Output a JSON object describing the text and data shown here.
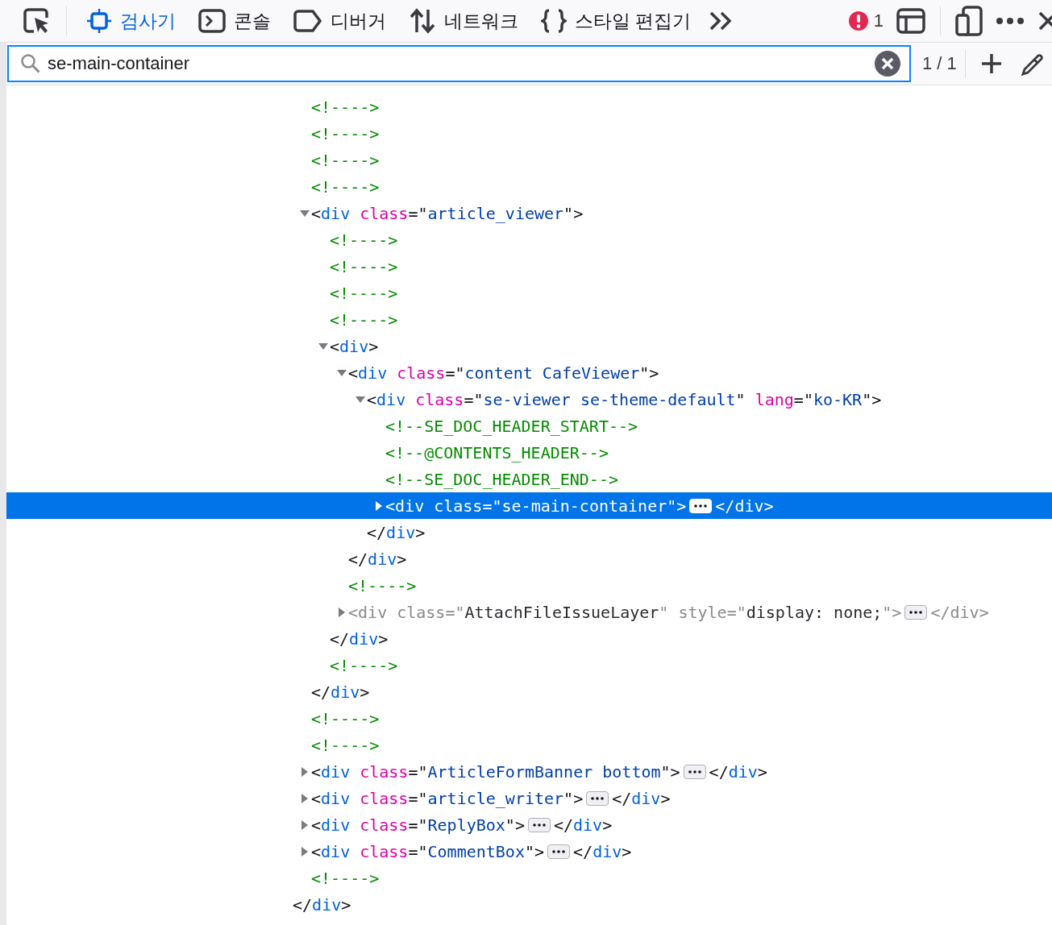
{
  "toolbar": {
    "tabs": [
      {
        "label": "검사기",
        "selected": true
      },
      {
        "label": "콘솔",
        "selected": false
      },
      {
        "label": "디버거",
        "selected": false
      },
      {
        "label": "네트워크",
        "selected": false
      },
      {
        "label": "스타일 편집기",
        "selected": false
      }
    ],
    "error_count": "1"
  },
  "search": {
    "value": "se-main-container",
    "match_count": "1 / 1"
  },
  "tree": {
    "children": [
      {
        "selected": false,
        "open": [
          {
            "comment": "<!---->"
          }
        ]
      },
      {
        "selected": false,
        "open": [
          {
            "comment": "<!---->"
          }
        ]
      },
      {
        "selected": false,
        "open": [
          {
            "comment": "<!---->"
          }
        ]
      },
      {
        "selected": false,
        "open": [
          {
            "comment": "<!---->"
          }
        ]
      },
      {
        "selected": false,
        "expanded": true,
        "open": [
          {
            "p": "<"
          },
          {
            "tag": "div"
          },
          {
            "attr": "class"
          },
          {
            "p": "=\""
          },
          {
            "val": "article_viewer"
          },
          {
            "p": "\">"
          }
        ],
        "close": [
          {
            "p": "</"
          },
          {
            "tag": "div"
          },
          {
            "p": ">"
          }
        ],
        "children": [
          {
            "selected": false,
            "open": [
              {
                "comment": "<!---->"
              }
            ]
          },
          {
            "selected": false,
            "open": [
              {
                "comment": "<!---->"
              }
            ]
          },
          {
            "selected": false,
            "open": [
              {
                "comment": "<!---->"
              }
            ]
          },
          {
            "selected": false,
            "open": [
              {
                "comment": "<!---->"
              }
            ]
          },
          {
            "selected": false,
            "expanded": true,
            "open": [
              {
                "p": "<"
              },
              {
                "tag": "div"
              },
              {
                "p": ">"
              }
            ],
            "close": [
              {
                "p": "</"
              },
              {
                "tag": "div"
              },
              {
                "p": ">"
              }
            ],
            "children": [
              {
                "selected": false,
                "expanded": true,
                "open": [
                  {
                    "p": "<"
                  },
                  {
                    "tag": "div"
                  },
                  {
                    "attr": "class"
                  },
                  {
                    "p": "=\""
                  },
                  {
                    "val": "content CafeViewer"
                  },
                  {
                    "p": "\">"
                  }
                ],
                "close": [
                  {
                    "p": "</"
                  },
                  {
                    "tag": "div"
                  },
                  {
                    "p": ">"
                  }
                ],
                "children": [
                  {
                    "selected": false,
                    "expanded": true,
                    "open": [
                      {
                        "p": "<"
                      },
                      {
                        "tag": "div"
                      },
                      {
                        "attr": "class"
                      },
                      {
                        "p": "=\""
                      },
                      {
                        "val": "se-viewer se-theme-default"
                      },
                      {
                        "p": "\""
                      },
                      {
                        "attr": "lang"
                      },
                      {
                        "p": "=\""
                      },
                      {
                        "val": "ko-KR"
                      },
                      {
                        "p": "\">"
                      }
                    ],
                    "close": [
                      {
                        "p": "</"
                      },
                      {
                        "tag": "div"
                      },
                      {
                        "p": ">"
                      }
                    ],
                    "children": [
                      {
                        "selected": false,
                        "open": [
                          {
                            "comment": "<!--SE_DOC_HEADER_START-->"
                          }
                        ]
                      },
                      {
                        "selected": false,
                        "open": [
                          {
                            "comment": "<!--@CONTENTS_HEADER-->"
                          }
                        ]
                      },
                      {
                        "selected": false,
                        "open": [
                          {
                            "comment": "<!--SE_DOC_HEADER_END-->"
                          }
                        ]
                      },
                      {
                        "selected": true,
                        "expanded": false,
                        "open": [
                          {
                            "p": "<"
                          },
                          {
                            "tag": "div"
                          },
                          {
                            "attr": "class"
                          },
                          {
                            "p": "=\""
                          },
                          {
                            "val": "se-main-container"
                          },
                          {
                            "p": "\">"
                          }
                        ],
                        "close": [
                          {
                            "p": "</"
                          },
                          {
                            "tag": "div"
                          },
                          {
                            "p": ">"
                          }
                        ]
                      }
                    ]
                  }
                ]
              },
              {
                "selected": false,
                "open": [
                  {
                    "comment": "<!---->"
                  }
                ]
              },
              {
                "selected": false,
                "dimmed": true,
                "expanded": false,
                "open": [
                  {
                    "p": "<"
                  },
                  {
                    "tag": "div"
                  },
                  {
                    "attr": "class"
                  },
                  {
                    "p": "=\""
                  },
                  {
                    "val": "AttachFileIssueLayer"
                  },
                  {
                    "p": "\""
                  },
                  {
                    "attr": "style"
                  },
                  {
                    "p": "=\""
                  },
                  {
                    "val": "display: none;"
                  },
                  {
                    "p": "\">"
                  }
                ],
                "close": [
                  {
                    "p": "</"
                  },
                  {
                    "tag": "div"
                  },
                  {
                    "p": ">"
                  }
                ]
              }
            ]
          },
          {
            "selected": false,
            "open": [
              {
                "comment": "<!---->"
              }
            ]
          }
        ]
      },
      {
        "selected": false,
        "open": [
          {
            "comment": "<!---->"
          }
        ]
      },
      {
        "selected": false,
        "open": [
          {
            "comment": "<!---->"
          }
        ]
      },
      {
        "selected": false,
        "expanded": false,
        "open": [
          {
            "p": "<"
          },
          {
            "tag": "div"
          },
          {
            "attr": "class"
          },
          {
            "p": "=\""
          },
          {
            "val": "ArticleFormBanner bottom"
          },
          {
            "p": "\">"
          }
        ],
        "close": [
          {
            "p": "</"
          },
          {
            "tag": "div"
          },
          {
            "p": ">"
          }
        ]
      },
      {
        "selected": false,
        "expanded": false,
        "open": [
          {
            "p": "<"
          },
          {
            "tag": "div"
          },
          {
            "attr": "class"
          },
          {
            "p": "=\""
          },
          {
            "val": "article_writer"
          },
          {
            "p": "\">"
          }
        ],
        "close": [
          {
            "p": "</"
          },
          {
            "tag": "div"
          },
          {
            "p": ">"
          }
        ]
      },
      {
        "selected": false,
        "expanded": false,
        "open": [
          {
            "p": "<"
          },
          {
            "tag": "div"
          },
          {
            "attr": "class"
          },
          {
            "p": "=\""
          },
          {
            "val": "ReplyBox"
          },
          {
            "p": "\">"
          }
        ],
        "close": [
          {
            "p": "</"
          },
          {
            "tag": "div"
          },
          {
            "p": ">"
          }
        ]
      },
      {
        "selected": false,
        "expanded": false,
        "open": [
          {
            "p": "<"
          },
          {
            "tag": "div"
          },
          {
            "attr": "class"
          },
          {
            "p": "=\""
          },
          {
            "val": "CommentBox"
          },
          {
            "p": "\">"
          }
        ],
        "close": [
          {
            "p": "</"
          },
          {
            "tag": "div"
          },
          {
            "p": ">"
          }
        ]
      },
      {
        "selected": false,
        "open": [
          {
            "comment": "<!---->"
          }
        ]
      }
    ],
    "close": [
      {
        "p": "</"
      },
      {
        "tag": "div"
      },
      {
        "p": ">"
      }
    ]
  }
}
